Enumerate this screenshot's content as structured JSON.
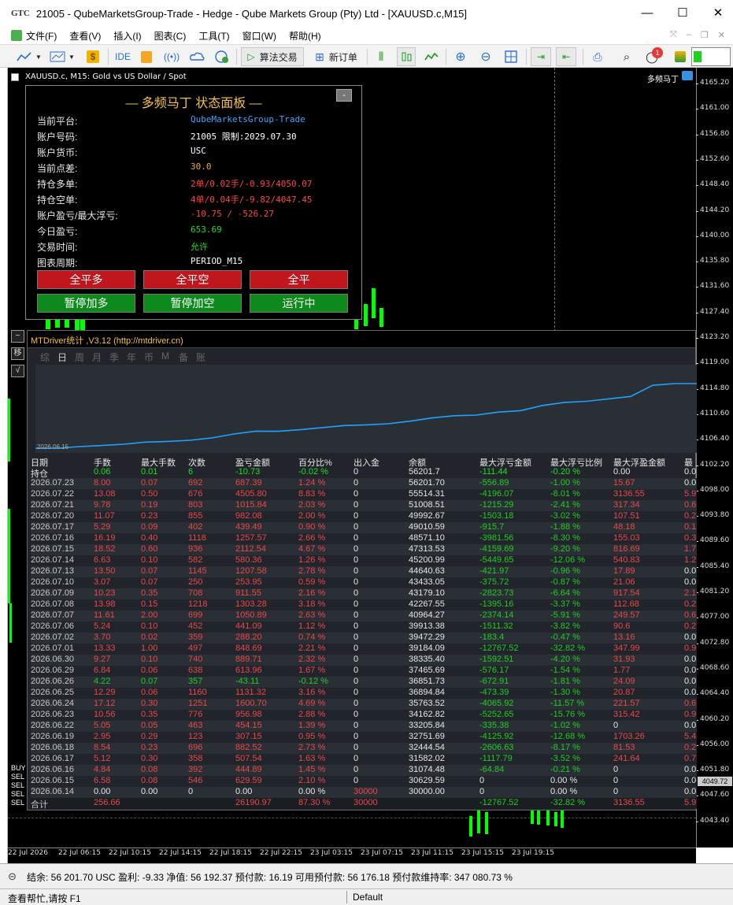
{
  "window": {
    "logo": "GTC",
    "title": "21005 - QubeMarketsGroup-Trade - Hedge - Qube Markets Group (Pty) Ltd - [XAUUSD.c,M15]"
  },
  "menu": [
    "文件(F)",
    "查看(V)",
    "插入(I)",
    "图表(C)",
    "工具(T)",
    "窗口(W)",
    "帮助(H)"
  ],
  "toolbar": {
    "ide": "IDE",
    "algo": "算法交易",
    "neworder": "新订单",
    "badge": "1"
  },
  "chart": {
    "symbol": "XAUUSD.c, M15:  Gold vs US Dollar / Spot",
    "ea": "多频马丁"
  },
  "price_axis": [
    "4165.20",
    "4161.00",
    "4156.80",
    "4152.60",
    "4148.40",
    "4144.20",
    "4140.00",
    "4135.80",
    "4131.60",
    "4127.40",
    "4123.20",
    "4119.00",
    "4114.80",
    "4110.60",
    "4106.40",
    "4102.20",
    "4098.00",
    "4093.80",
    "4089.60",
    "4085.40",
    "4081.20",
    "4077.00",
    "4072.80",
    "4068.60",
    "4064.40",
    "4060.20",
    "4056.00",
    "4051.80",
    "4047.60",
    "4043.40"
  ],
  "price_current": "4049.72",
  "time_axis": [
    "22 Jul 2026",
    "22 Jul 06:15",
    "22 Jul 10:15",
    "22 Jul 14:15",
    "22 Jul 18:15",
    "22 Jul 22:15",
    "23 Jul 03:15",
    "23 Jul 07:15",
    "23 Jul 11:15",
    "23 Jul 15:15",
    "23 Jul 19:15"
  ],
  "panel": {
    "title": "— 多频马丁 状态面板 —",
    "min": "-",
    "rows": [
      {
        "label": "当前平台:",
        "value": "QubeMarketsGroup-Trade",
        "color": "#3fa7ff"
      },
      {
        "label": "账户号码:",
        "value": "21005 限制:2029.07.30",
        "color": "#ffffff"
      },
      {
        "label": "账户货币:",
        "value": "USC",
        "color": "#ffffff"
      },
      {
        "label": "当前点差:",
        "value": "30.0",
        "color": "#f5a623"
      },
      {
        "label": "持仓多单:",
        "value": "2单/0.02手/-0.93/4050.07",
        "color": "#ff4444"
      },
      {
        "label": "持仓空单:",
        "value": "4单/0.04手/-9.82/4047.45",
        "color": "#ff4444"
      },
      {
        "label": "账户盈亏/最大浮亏:",
        "value": "-10.75 / -526.27",
        "color": "#ff4444"
      },
      {
        "label": "今日盈亏:",
        "value": "653.69",
        "color": "#22dd22"
      },
      {
        "label": "交易时间:",
        "value": "允许",
        "color": "#22dd22"
      },
      {
        "label": "图表周期:",
        "value": "PERIOD_M15",
        "color": "#ffffff"
      }
    ],
    "buttons": [
      {
        "label": "全平多",
        "style": "red"
      },
      {
        "label": "全平空",
        "style": "red"
      },
      {
        "label": "全平",
        "style": "red"
      },
      {
        "label": "暂停加多",
        "style": "grn"
      },
      {
        "label": "暂停加空",
        "style": "grn"
      },
      {
        "label": "运行中",
        "style": "grn"
      }
    ]
  },
  "stats": {
    "title": "MTDriver统计 ,V3.12 (http://mtdriver.cn)",
    "tabs": [
      "综",
      "日",
      "周",
      "月",
      "季",
      "年",
      "币",
      "M",
      "备",
      "账户"
    ],
    "active_tab": "日",
    "curve_date": "2026.06.15",
    "headers": [
      "日期",
      "手数",
      "最大手数",
      "次数",
      "盈亏金额",
      "百分比%",
      "出入金",
      "余额",
      "最大浮亏金额",
      "最大浮亏比例",
      "最大浮盈金额",
      "最"
    ],
    "holding": [
      "持仓",
      "0.06",
      "0.01",
      "6",
      "-10.73",
      "-0.02 %",
      "0",
      "56201.7",
      "-111.44",
      "-0.20 %",
      "0.00",
      "0.0"
    ],
    "rows": [
      [
        "2026.07.23",
        "8.00",
        "0.07",
        "692",
        "687.39",
        "1.24 %",
        "0",
        "56201.70",
        "-556.89",
        "-1.00 %",
        "15.67",
        "0.0"
      ],
      [
        "2026.07.22",
        "13.08",
        "0.50",
        "676",
        "4505.80",
        "8.83 %",
        "0",
        "55514.31",
        "-4196.07",
        "-8.01 %",
        "3136.55",
        "5.9"
      ],
      [
        "2026.07.21",
        "9.78",
        "0.19",
        "803",
        "1015.84",
        "2.03 %",
        "0",
        "51008.51",
        "-1215.29",
        "-2.41 %",
        "317.34",
        "0.6"
      ],
      [
        "2026.07.20",
        "11.07",
        "0.23",
        "855",
        "982.08",
        "2.00 %",
        "0",
        "49992.67",
        "-1503.18",
        "-3.02 %",
        "107.51",
        "0.2"
      ],
      [
        "2026.07.17",
        "5.29",
        "0.09",
        "402",
        "439.49",
        "0.90 %",
        "0",
        "49010.59",
        "-915.7",
        "-1.88 %",
        "48.18",
        "0.1"
      ],
      [
        "2026.07.16",
        "16.19",
        "0.40",
        "1118",
        "1257.57",
        "2.66 %",
        "0",
        "48571.10",
        "-3981.56",
        "-8.30 %",
        "155.03",
        "0.3"
      ],
      [
        "2026.07.15",
        "18.52",
        "0.60",
        "936",
        "2112.54",
        "4.67 %",
        "0",
        "47313.53",
        "-4159.69",
        "-9.20 %",
        "816.69",
        "1.7"
      ],
      [
        "2026.07.14",
        "6.63",
        "0.10",
        "582",
        "580.36",
        "1.26 %",
        "0",
        "45200.99",
        "-5449.65",
        "-12.06 %",
        "540.83",
        "1.2"
      ],
      [
        "2026.07.13",
        "13.50",
        "0.07",
        "1145",
        "1207.58",
        "2.78 %",
        "0",
        "44640.63",
        "-421.97",
        "-0.96 %",
        "17.89",
        "0.0"
      ],
      [
        "2026.07.10",
        "3.07",
        "0.07",
        "250",
        "253.95",
        "0.59 %",
        "0",
        "43433.05",
        "-375.72",
        "-0.87 %",
        "21.06",
        "0.0"
      ],
      [
        "2026.07.09",
        "10.23",
        "0.35",
        "708",
        "911.55",
        "2.16 %",
        "0",
        "43179.10",
        "-2823.73",
        "-6.64 %",
        "917.54",
        "2.1"
      ],
      [
        "2026.07.08",
        "13.98",
        "0.15",
        "1218",
        "1303.28",
        "3.18 %",
        "0",
        "42267.55",
        "-1395.16",
        "-3.37 %",
        "112.68",
        "0.2"
      ],
      [
        "2026.07.07",
        "11.61",
        "2.00",
        "699",
        "1050.89",
        "2.63 %",
        "0",
        "40964.27",
        "-2374.14",
        "-5.91 %",
        "249.57",
        "0.6"
      ],
      [
        "2026.07.06",
        "5.24",
        "0.10",
        "452",
        "441.09",
        "1.12 %",
        "0",
        "39913.38",
        "-1511.32",
        "-3.82 %",
        "90.6",
        "0.2"
      ],
      [
        "2026.07.02",
        "3.70",
        "0.02",
        "359",
        "288.20",
        "0.74 %",
        "0",
        "39472.29",
        "-183.4",
        "-0.47 %",
        "13.16",
        "0.0"
      ],
      [
        "2026.07.01",
        "13.33",
        "1.00",
        "497",
        "848.69",
        "2.21 %",
        "0",
        "39184.09",
        "-12767.52",
        "-32.82 %",
        "347.99",
        "0.9"
      ],
      [
        "2026.06.30",
        "9.27",
        "0.10",
        "740",
        "889.71",
        "2.32 %",
        "0",
        "38335.40",
        "-1592.51",
        "-4.20 %",
        "31.93",
        "0.0"
      ],
      [
        "2026.06.29",
        "6.84",
        "0.06",
        "638",
        "613.96",
        "1.67 %",
        "0",
        "37465.69",
        "-576.17",
        "-1.54 %",
        "1.77",
        "0.0"
      ],
      [
        "2026.06.26",
        "4.22",
        "0.07",
        "357",
        "-43.11",
        "-0.12 %",
        "0",
        "36851.73",
        "-672.91",
        "-1.81 %",
        "24.09",
        "0.0"
      ],
      [
        "2026.06.25",
        "12.29",
        "0.06",
        "1160",
        "1131.32",
        "3.16 %",
        "0",
        "36894.84",
        "-473.39",
        "-1.30 %",
        "20.87",
        "0.0"
      ],
      [
        "2026.06.24",
        "17.12",
        "0.30",
        "1251",
        "1600.70",
        "4.69 %",
        "0",
        "35763.52",
        "-4065.92",
        "-11.57 %",
        "221.57",
        "0.6"
      ],
      [
        "2026.06.23",
        "10.56",
        "0.35",
        "776",
        "956.98",
        "2.88 %",
        "0",
        "34162.82",
        "-5252.65",
        "-15.76 %",
        "315.42",
        "0.9"
      ],
      [
        "2026.06.22",
        "5.05",
        "0.05",
        "463",
        "454.15",
        "1.39 %",
        "0",
        "33205.84",
        "-335.38",
        "-1.02 %",
        "0",
        "0.0"
      ],
      [
        "2026.06.19",
        "2.95",
        "0.29",
        "123",
        "307.15",
        "0.95 %",
        "0",
        "32751.69",
        "-4125.92",
        "-12.68 %",
        "1703.26",
        "5.4"
      ],
      [
        "2026.06.18",
        "8.54",
        "0.23",
        "696",
        "882.52",
        "2.73 %",
        "0",
        "32444.54",
        "-2606.63",
        "-8.17 %",
        "81.53",
        "0.2"
      ],
      [
        "2026.06.17",
        "5.12",
        "0.30",
        "358",
        "507.54",
        "1.63 %",
        "0",
        "31582.02",
        "-1117.79",
        "-3.52 %",
        "241.64",
        "0.7"
      ],
      [
        "2026.06.16",
        "4.84",
        "0.08",
        "392",
        "444.89",
        "1.45 %",
        "0",
        "31074.48",
        "-64.84",
        "-0.21 %",
        "0",
        "0.0"
      ],
      [
        "2026.06.15",
        "6.58",
        "0.08",
        "546",
        "629.59",
        "2.10 %",
        "0",
        "30629.59",
        "0",
        "0.00 %",
        "0",
        "0.0"
      ],
      [
        "2026.06.14",
        "0.00",
        "0.00",
        "0",
        "0.00",
        "0.00 %",
        "30000",
        "30000.00",
        "0",
        "0.00 %",
        "0",
        "0.0"
      ]
    ],
    "total": [
      "合计",
      "256.66",
      "",
      "",
      "26190.97",
      "87.30 %",
      "30000",
      "",
      "-12767.52",
      "-32.82 %",
      "3136.55",
      "5.9"
    ]
  },
  "equity_curve": [
    30000,
    30000,
    30630,
    31074,
    31582,
    32445,
    32752,
    33206,
    34163,
    35764,
    36895,
    36852,
    37466,
    38335,
    39184,
    39472,
    39913,
    40964,
    42268,
    43179,
    43433,
    44641,
    45201,
    47314,
    48571,
    49011,
    49993,
    51009,
    55514,
    56202,
    56202
  ],
  "side_buttons": [
    "−",
    "移",
    "√"
  ],
  "side_labels": [
    "BUY",
    "SEL",
    "SEL",
    "SEL",
    "SEL"
  ],
  "account_bar": {
    "icon": "⊝",
    "text": "结余: 56 201.70 USC  盈利: -9.33  净值: 56 192.37  预付款: 16.19  可用预付款: 56 176.18  预付款维持率: 347 080.73 %"
  },
  "statusbar": {
    "help": "查看帮忙,请按 F1",
    "profile": "Default"
  }
}
